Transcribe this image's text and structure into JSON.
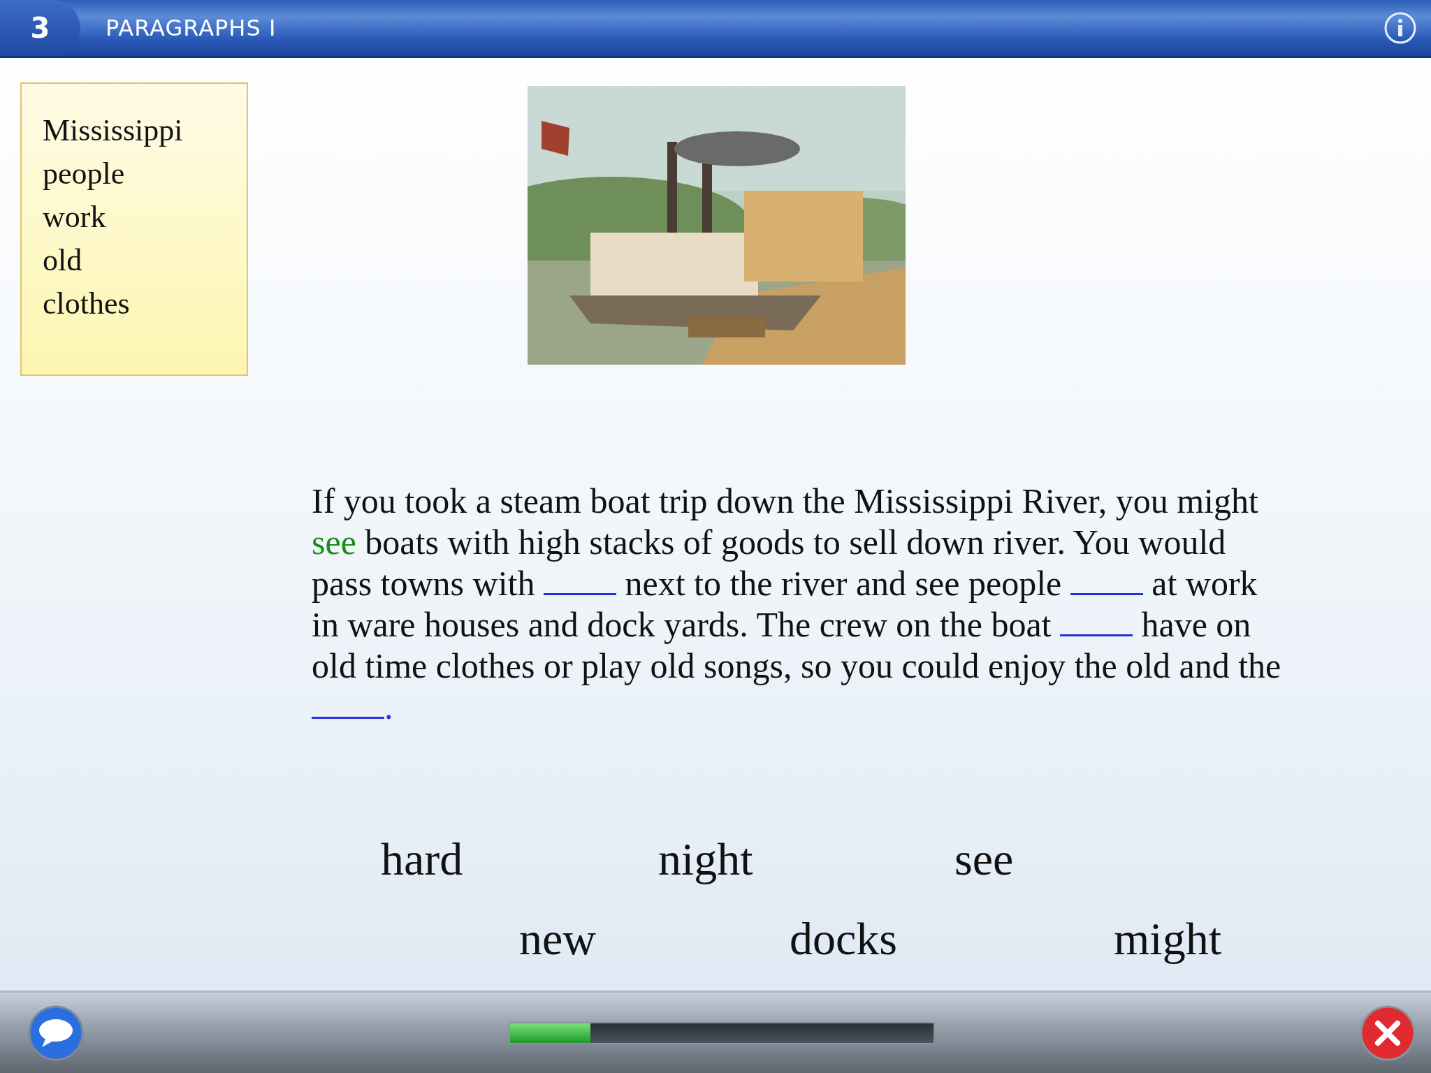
{
  "header": {
    "number": "3",
    "title": "PARAGRAPHS I"
  },
  "word_list": [
    "Mississippi",
    "people",
    "work",
    "old",
    "clothes"
  ],
  "passage": [
    {
      "kind": "text",
      "text": "If you took a steam boat trip down the Mississippi River, you might "
    },
    {
      "kind": "answer",
      "text": "see"
    },
    {
      "kind": "text",
      "text": " boats with high stacks of goods to sell down river.  You would pass towns with "
    },
    {
      "kind": "blank"
    },
    {
      "kind": "text",
      "text": " next to the river and see people "
    },
    {
      "kind": "blank"
    },
    {
      "kind": "text",
      "text": " at work in ware houses and dock yards.  The crew on the boat "
    },
    {
      "kind": "blank"
    },
    {
      "kind": "text",
      "text": " have on old time clothes or play old songs, so you could enjoy the old and the "
    },
    {
      "kind": "blank"
    },
    {
      "kind": "mark",
      "text": "."
    }
  ],
  "word_bank": [
    [
      "hard",
      "night",
      "see"
    ],
    [
      "new",
      "docks",
      "might"
    ]
  ],
  "progress": {
    "level": 0.19
  }
}
